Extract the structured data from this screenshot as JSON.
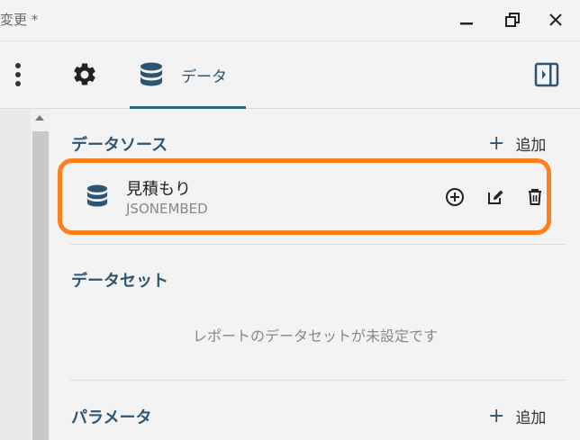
{
  "window": {
    "title": "変更 *"
  },
  "toolbar": {
    "data_tab_label": "データ"
  },
  "datasource": {
    "title": "データソース",
    "add_label": "追加",
    "items": [
      {
        "name": "見積もり",
        "type": "JSONEMBED"
      }
    ]
  },
  "dataset": {
    "title": "データセット",
    "empty_message": "レポートのデータセットが未設定です"
  },
  "parameter": {
    "title": "パラメータ",
    "add_label": "追加"
  },
  "colors": {
    "accent": "#2d5571",
    "highlight": "#ff7f1f"
  }
}
